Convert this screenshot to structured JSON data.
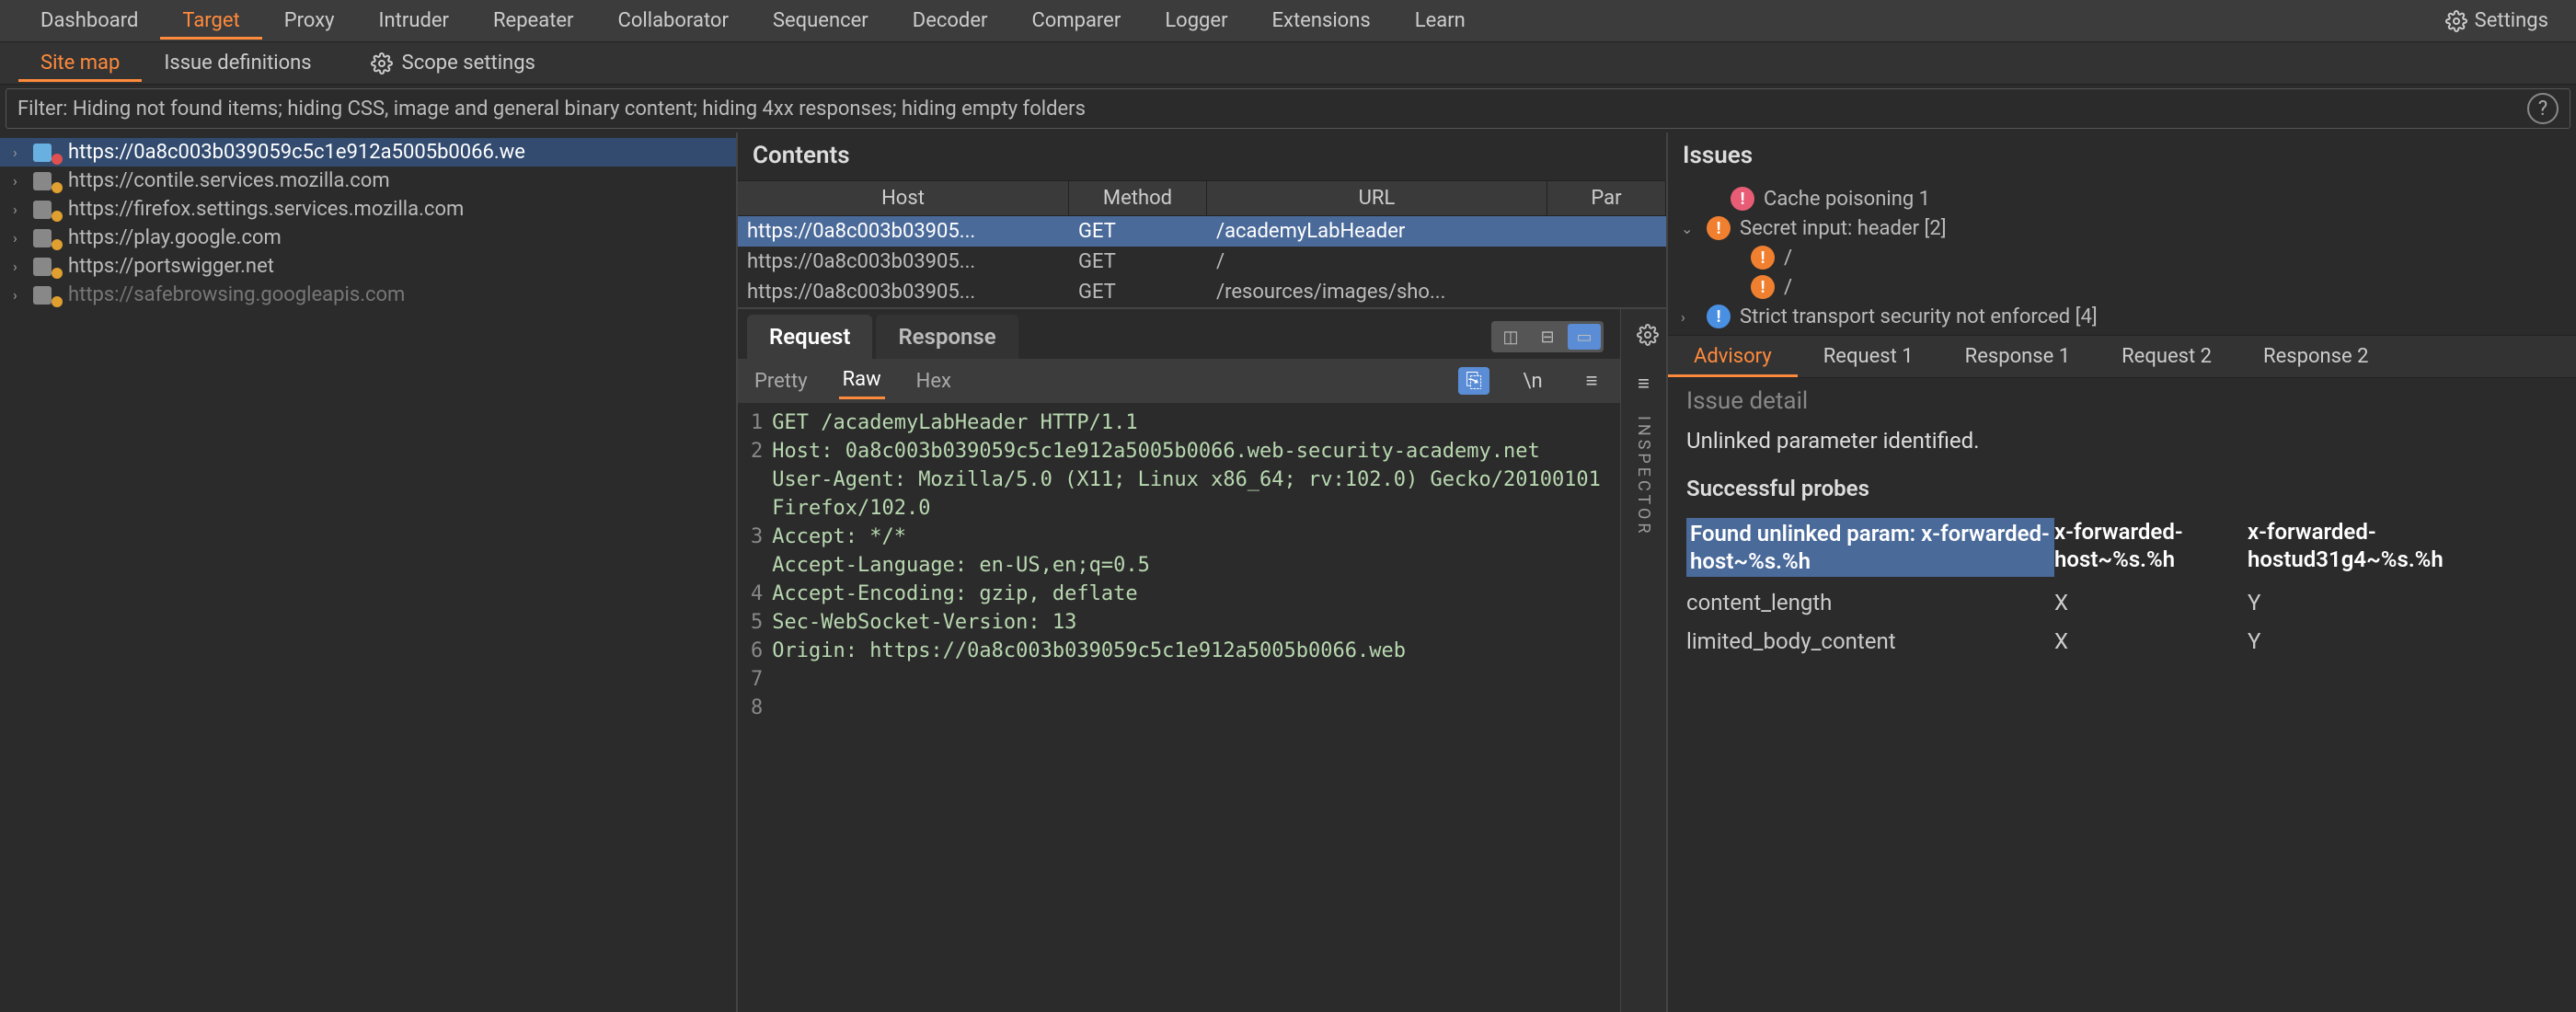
{
  "topTabs": [
    "Dashboard",
    "Target",
    "Proxy",
    "Intruder",
    "Repeater",
    "Collaborator",
    "Sequencer",
    "Decoder",
    "Comparer",
    "Logger",
    "Extensions",
    "Learn"
  ],
  "topActiveIndex": 1,
  "settingsLabel": "Settings",
  "subTabs": [
    "Site map",
    "Issue definitions"
  ],
  "subActiveIndex": 0,
  "scopeSettingsLabel": "Scope settings",
  "filterText": "Filter: Hiding not found items;  hiding CSS, image and general binary content;  hiding 4xx responses;  hiding empty folders",
  "tree": [
    {
      "label": "https://0a8c003b039059c5c1e912a5005b0066.we",
      "selected": true,
      "inactive": false,
      "redDot": true
    },
    {
      "label": "https://contile.services.mozilla.com",
      "selected": false,
      "inactive": false,
      "grey": true
    },
    {
      "label": "https://firefox.settings.services.mozilla.com",
      "selected": false,
      "inactive": false,
      "grey": true
    },
    {
      "label": "https://play.google.com",
      "selected": false,
      "inactive": false,
      "grey": true
    },
    {
      "label": "https://portswigger.net",
      "selected": false,
      "inactive": false,
      "grey": true
    },
    {
      "label": "https://safebrowsing.googleapis.com",
      "selected": false,
      "inactive": true,
      "grey": true
    }
  ],
  "contentsHeader": "Contents",
  "contentsCols": {
    "host": "Host",
    "method": "Method",
    "url": "URL",
    "par": "Par"
  },
  "contentsRows": [
    {
      "host": "https://0a8c003b03905...",
      "method": "GET",
      "url": "/academyLabHeader",
      "selected": true
    },
    {
      "host": "https://0a8c003b03905...",
      "method": "GET",
      "url": "/",
      "selected": false
    },
    {
      "host": "https://0a8c003b03905...",
      "method": "GET",
      "url": "/resources/images/sho...",
      "selected": false
    }
  ],
  "reqresTabs": {
    "request": "Request",
    "response": "Response",
    "active": "request"
  },
  "viewTabs": {
    "pretty": "Pretty",
    "raw": "Raw",
    "hex": "Hex",
    "active": "raw"
  },
  "requestLines": [
    "GET /academyLabHeader HTTP/1.1",
    "Host: 0a8c003b039059c5c1e912a5005b0066.web-security-academy.net",
    "User-Agent: Mozilla/5.0 (X11; Linux x86_64; rv:102.0) Gecko/20100101 Firefox/102.0",
    "Accept: */*",
    "Accept-Language: en-US,en;q=0.5",
    "Accept-Encoding: gzip, deflate",
    "Sec-WebSocket-Version: 13",
    "Origin: https://0a8c003b039059c5c1e912a5005b0066.web"
  ],
  "lineNums": "1\n2\n\n\n3\n\n4\n5\n6\n7\n8\n",
  "inspectorLabel": "INSPECTOR",
  "issuesHeader": "Issues",
  "issues": [
    {
      "sev": "high",
      "label": "Cache poisoning 1",
      "indent": 0,
      "chevron": ""
    },
    {
      "sev": "med",
      "label": "Secret input: header [2]",
      "indent": 0,
      "chevron": "⌄"
    },
    {
      "sev": "med",
      "label": "/",
      "indent": 2,
      "chevron": ""
    },
    {
      "sev": "med",
      "label": "/",
      "indent": 2,
      "chevron": ""
    },
    {
      "sev": "info",
      "label": "Strict transport security not enforced [4]",
      "indent": 0,
      "chevron": "›"
    }
  ],
  "advisoryTabs": [
    "Advisory",
    "Request 1",
    "Response 1",
    "Request 2",
    "Response 2"
  ],
  "advisoryActiveIndex": 0,
  "detail": {
    "headingCut": "Issue detail",
    "text": "Unlinked parameter identified.",
    "subhead": "Successful probes",
    "probes": {
      "h0": "Found unlinked param: x-forwarded-host~%s.%h",
      "h1": "x-forwarded-host~%s.%h",
      "h2": "x-forwarded-hostud31g4~%s.%h",
      "rows": [
        {
          "k": "content_length",
          "a": "X",
          "b": "Y"
        },
        {
          "k": "limited_body_content",
          "a": "X",
          "b": "Y"
        }
      ]
    }
  }
}
